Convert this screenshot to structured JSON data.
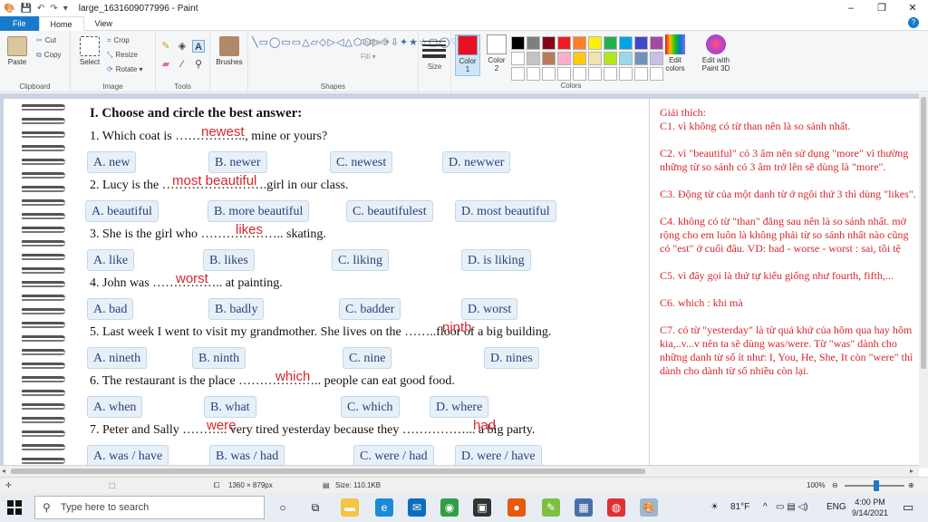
{
  "window": {
    "title": "large_1631609077996 - Paint",
    "minimize": "–",
    "maximize": "❐",
    "close": "✕"
  },
  "tabs": [
    {
      "label": "File"
    },
    {
      "label": "Home"
    },
    {
      "label": "View"
    }
  ],
  "ribbon": {
    "clipboard": {
      "label": "Clipboard",
      "paste": "Paste",
      "cut": "Cut",
      "copy": "Copy"
    },
    "image": {
      "label": "Image",
      "select": "Select",
      "crop": "Crop",
      "resize": "Resize",
      "rotate": "Rotate ▾"
    },
    "tools": {
      "label": "Tools"
    },
    "brushes": {
      "label": "Brushes"
    },
    "shapes": {
      "label": "Shapes",
      "outline": "Outline ▾",
      "fill": "Fill ▾"
    },
    "size": {
      "label": "Size"
    },
    "colors": {
      "label": "Colors",
      "color1": "Color\n1",
      "color2": "Color\n2",
      "edit": "Edit\ncolors",
      "paint3d": "Edit with\nPaint 3D",
      "color1_value": "#e81123",
      "color2_value": "#ffffff",
      "palette": [
        "#000000",
        "#7f7f7f",
        "#880015",
        "#ed1c24",
        "#ff7f27",
        "#fff200",
        "#22b14c",
        "#00a2e8",
        "#3f48cc",
        "#a349a4",
        "#ffffff",
        "#c3c3c3",
        "#b97a57",
        "#ffaec9",
        "#ffc90e",
        "#efe4b0",
        "#b5e61d",
        "#99d9ea",
        "#7092be",
        "#c8bfe7",
        "#ffffff",
        "#ffffff",
        "#ffffff",
        "#ffffff",
        "#ffffff",
        "#ffffff",
        "#ffffff",
        "#ffffff",
        "#ffffff",
        "#ffffff"
      ]
    }
  },
  "worksheet": {
    "heading": "I. Choose and circle the best answer:",
    "questions": [
      {
        "text": "1. Which coat is …………….., mine or yours?",
        "answer": "newest",
        "options": [
          "A. new",
          "B. newer",
          "C. newest",
          "D. newwer"
        ]
      },
      {
        "text": "2. Lucy is the …………………….girl in our class.",
        "answer": "most beautiful",
        "options": [
          "A. beautiful",
          "B. more beautiful",
          "C. beautifulest",
          "D. most beautiful"
        ]
      },
      {
        "text": "3. She is the girl who ……………….. skating.",
        "answer": "likes",
        "options": [
          "A. like",
          "B. likes",
          "C. liking",
          "D. is liking"
        ]
      },
      {
        "text": "4. John was …………….. at painting.",
        "answer": "worst",
        "options": [
          "A. bad",
          "B. badly",
          "C. badder",
          "D. worst"
        ]
      },
      {
        "text": "5. Last week I went to visit my grandmother. She lives on the ……..floor of a big building.",
        "answer": "ninth",
        "options": [
          "A. nineth",
          "B. ninth",
          "C. nine",
          "D. nines"
        ]
      },
      {
        "text": "6. The restaurant is the place ……………….. people can eat good food.",
        "answer": "which",
        "options": [
          "A. when",
          "B. what",
          "C. which",
          "D. where"
        ]
      },
      {
        "text": "7. Peter and Sally ……….. very tired yesterday because they ……………... a big party.",
        "answer": "were",
        "answer2": "had",
        "options": [
          "A. was / have",
          "B. was / had",
          "C. were / had",
          "D. were / have"
        ]
      }
    ],
    "explanation": "Giải thích:\nC1. vì không có từ than nên là so sánh nhất.\n\nC2. vì \"beautiful\" có 3 âm nên sử dụng \"more\" vì thường những từ so sánh có 3 âm trở lên sẽ dùng là \"more\".\n\nC3. Động từ của một danh từ ở ngôi thứ 3 thì dùng \"likes\".\n\nC4. không có từ \"than\" đằng sau nên là so sánh nhất. mở rộng cho em luôn là không phải từ so sánh nhất nào cũng có \"est\" ở cuối đâu. VD: bad - worse - worst : sai, tồi tệ\n\nC5. vì đây gọi là thứ tự kiểu giống như fourth, fifth,...\n\nC6. which : khi mà\n\nC7. có từ \"yesterday\" là từ quá khứ của hôm qua hay hôm kia,..v...v nên ta sẽ dùng was/were. Từ \"was\" dành cho những danh từ số ít như: I, You, He, She, It còn \"were\" thì dành cho dành từ số nhiều còn lại."
  },
  "statusbar": {
    "dimensions": "1360 × 879px",
    "size": "Size: 110.1KB",
    "zoom": "100%"
  },
  "taskbar": {
    "search_placeholder": "Type here to search",
    "temperature": "81°F",
    "language": "ENG",
    "time": "4:00 PM",
    "date": "9/14/2021"
  }
}
